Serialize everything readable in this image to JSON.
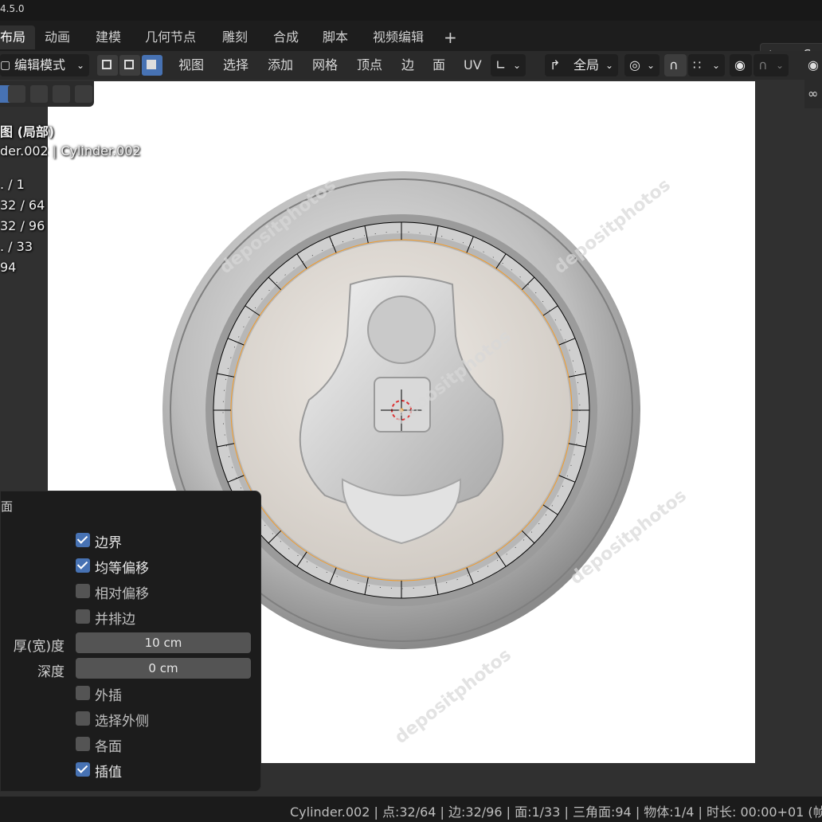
{
  "app": {
    "version": "4.5.0"
  },
  "workspace_tabs": [
    {
      "label": "布局",
      "active": true
    },
    {
      "label": "动画"
    },
    {
      "label": "建模"
    },
    {
      "label": "几何节点"
    },
    {
      "label": "雕刻"
    },
    {
      "label": "合成"
    },
    {
      "label": "脚本"
    },
    {
      "label": "视频编辑"
    },
    {
      "label": "+"
    }
  ],
  "scene": {
    "label": "Sc",
    "icon": "scene-icon"
  },
  "header": {
    "mode": "编辑模式",
    "menus": [
      "视图",
      "选择",
      "添加",
      "网格",
      "顶点",
      "边",
      "面",
      "UV"
    ],
    "transform_orientation": "全局"
  },
  "viewport_overlay": {
    "view_name": "图 (局部)",
    "object_line": "der.002",
    "object_name": "Cylinder.002",
    "stats": [
      ". / 1",
      "32 / 64",
      "32 / 96",
      ". / 33",
      "94"
    ]
  },
  "image_watermark": "depositphotos",
  "inset_panel": {
    "title": "面",
    "checkboxes": [
      {
        "label": "边界",
        "checked": true
      },
      {
        "label": "均等偏移",
        "checked": true
      },
      {
        "label": "相对偏移",
        "checked": false
      },
      {
        "label": "并排边",
        "checked": false
      }
    ],
    "thickness": {
      "label": "厚(宽)度",
      "value": "10 cm"
    },
    "depth": {
      "label": "深度",
      "value": "0 cm"
    },
    "checkboxes2": [
      {
        "label": "外插",
        "checked": false
      },
      {
        "label": "选择外侧",
        "checked": false
      },
      {
        "label": "各面",
        "checked": false
      },
      {
        "label": "插值",
        "checked": true
      }
    ]
  },
  "status_bar": "Cylinder.002 | 点:32/64 | 边:32/96 | 面:1/33 | 三角面:94 | 物体:1/4 | 时长: 00:00+01 (帧"
}
